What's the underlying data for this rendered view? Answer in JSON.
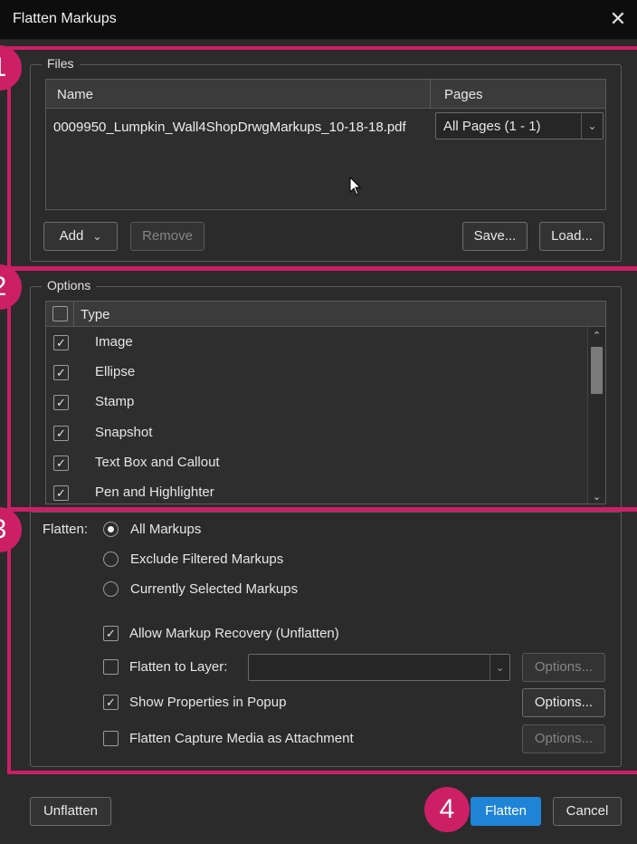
{
  "window": {
    "title": "Flatten Markups",
    "close_glyph": "✕"
  },
  "files": {
    "legend": "Files",
    "columns": {
      "name": "Name",
      "pages": "Pages"
    },
    "rows": [
      {
        "name": "0009950_Lumpkin_Wall4ShopDrwgMarkups_10-18-18.pdf",
        "pages": "All Pages (1 - 1)"
      }
    ],
    "buttons": {
      "add": "Add",
      "remove": "Remove",
      "save": "Save...",
      "load": "Load..."
    }
  },
  "options": {
    "legend": "Options",
    "column_type": "Type",
    "items": [
      {
        "label": "Image",
        "checked": true
      },
      {
        "label": "Ellipse",
        "checked": true
      },
      {
        "label": "Stamp",
        "checked": true
      },
      {
        "label": "Snapshot",
        "checked": true
      },
      {
        "label": "Text Box and Callout",
        "checked": true
      },
      {
        "label": "Pen and Highlighter",
        "checked": true
      }
    ]
  },
  "flatten": {
    "label": "Flatten:",
    "radios": [
      {
        "label": "All Markups",
        "selected": true
      },
      {
        "label": "Exclude Filtered Markups",
        "selected": false
      },
      {
        "label": "Currently Selected Markups",
        "selected": false
      }
    ],
    "checkboxes": {
      "allow_recovery": {
        "label": "Allow Markup Recovery (Unflatten)",
        "checked": true
      },
      "flatten_to_layer": {
        "label": "Flatten to Layer:",
        "checked": false
      },
      "show_properties": {
        "label": "Show Properties in Popup",
        "checked": true
      },
      "capture_media": {
        "label": "Flatten Capture Media as Attachment",
        "checked": false
      }
    },
    "options_label": "Options..."
  },
  "footer": {
    "unflatten": "Unflatten",
    "flatten": "Flatten",
    "cancel": "Cancel"
  },
  "annotations": {
    "badges": [
      "1",
      "2",
      "3",
      "4"
    ],
    "color": "#cc1f66"
  },
  "colors": {
    "accent_blue": "#1f83d6",
    "annotation_pink": "#cc1f66"
  }
}
